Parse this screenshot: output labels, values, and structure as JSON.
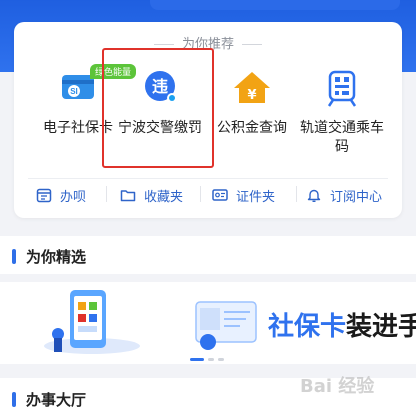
{
  "recommend": {
    "title": "为你推荐",
    "badge": "绿色能量",
    "services": [
      {
        "label": "电子社保卡",
        "icon": "social-security-card-icon"
      },
      {
        "label": "宁波交警缴罚",
        "icon": "traffic-fine-icon",
        "icon_char": "违"
      },
      {
        "label": "公积金查询",
        "icon": "housing-fund-icon",
        "icon_char": "¥"
      },
      {
        "label": "轨道交通乘车码",
        "icon": "metro-qr-icon"
      }
    ]
  },
  "quick_links": [
    {
      "label": "办呗",
      "icon": "calendar-icon"
    },
    {
      "label": "收藏夹",
      "icon": "folder-icon"
    },
    {
      "label": "证件夹",
      "icon": "id-card-icon"
    },
    {
      "label": "订阅中心",
      "icon": "bell-icon"
    }
  ],
  "picks": {
    "title": "为你精选",
    "banner_highlight": "社保卡",
    "banner_rest": "装进手"
  },
  "hall": {
    "title": "办事大厅"
  },
  "watermark": "Bai 经验",
  "colors": {
    "brand_blue": "#2f72ee",
    "highlight_red": "#e0322b",
    "badge_green": "#5cc43a",
    "fund_orange": "#f2a314"
  }
}
